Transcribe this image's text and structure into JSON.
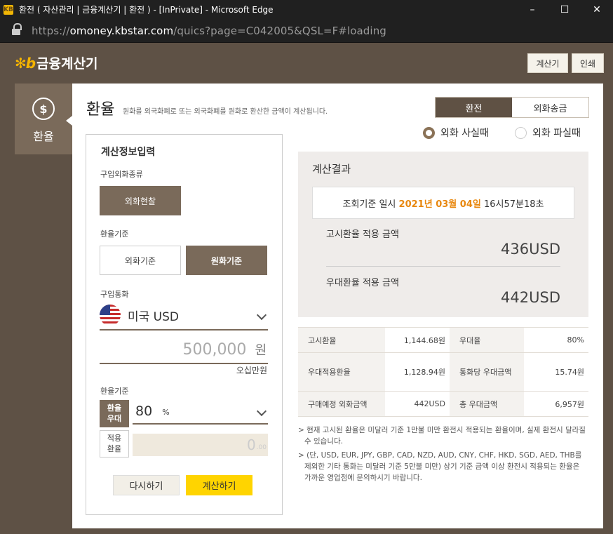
{
  "browser": {
    "title": "환전 ( 자산관리 | 금융계산기 | 환전 ) - [InPrivate] - Microsoft Edge",
    "url_prefix": "https://",
    "url_host": "omoney.kbstar.com",
    "url_path": "/quics?page=C042005&QSL=F#loading",
    "minimize": "–",
    "maximize": "☐",
    "close": "✕"
  },
  "header": {
    "logo_mark": "KB",
    "app_title": "금융계산기",
    "calculator_button": "계산기",
    "print_button": "인쇄"
  },
  "side_tab": {
    "label": "환율",
    "icon": "$"
  },
  "page": {
    "title": "환율",
    "description": "원화를 외국화폐로 또는 외국화폐를 원화로 환산한 금액이 계산됩니다.",
    "mode_tabs": [
      "환전",
      "외화송금"
    ],
    "radio_buy": "외화 사실때",
    "radio_sell": "외화 파실때"
  },
  "input": {
    "section_title": "계산정보입력",
    "buy_type_label": "구입외화종류",
    "buy_type_button": "외화현찰",
    "basis_label": "환율기준",
    "basis_foreign": "외화기준",
    "basis_won": "원화기준",
    "currency_label": "구입통화",
    "currency_value": "미국 USD",
    "amount_value": "500,000",
    "amount_unit": "원",
    "amount_korean": "오십만원",
    "rate_basis_label": "환율기준",
    "pref_tag_line1": "환율",
    "pref_tag_line2": "우대",
    "pref_value": "80",
    "pref_unit": "%",
    "applied_tag_line1": "적용",
    "applied_tag_line2": "환율",
    "applied_value": "0",
    "applied_decimal": ".00",
    "reset_button": "다시하기",
    "calc_button": "계산하기"
  },
  "result": {
    "title": "계산결과",
    "date_prefix": "조회기준 일시",
    "date_highlight": "2021년 03월 04일",
    "date_time": "16시57분18초",
    "notice_label": "고시환율 적용 금액",
    "notice_value": "436USD",
    "pref_label": "우대환율 적용 금액",
    "pref_value": "442USD"
  },
  "rate_table": {
    "rows": [
      [
        "고시환율",
        "1,144.68원",
        "우대율",
        "80%"
      ],
      [
        "우대적용환율",
        "1,128.94원",
        "통화당 우대금액",
        "15.74원"
      ],
      [
        "구매예정 외화금액",
        "442USD",
        "총 우대금액",
        "6,957원"
      ]
    ]
  },
  "notes": [
    "> 현재 고시된 환율은 미달러 기준 1만불 미만 환전시 적용되는 환율이며, 실제 환전시 달라질 수 있습니다.",
    "> (단, USD, EUR, JPY, GBP, CAD, NZD, AUD, CNY, CHF, HKD, SGD, AED, THB를 제외한 기타 통화는 미달러 기준 5만불 미만) 상기 기준 금액 이상 환전시 적용되는 환율은 가까운 영업점에 문의하시기 바랍니다."
  ],
  "colors": {
    "brand_brown": "#7a6a5a",
    "dark_brown": "#5f5144",
    "accent_yellow": "#ffd400",
    "date_orange": "#e8870e"
  }
}
